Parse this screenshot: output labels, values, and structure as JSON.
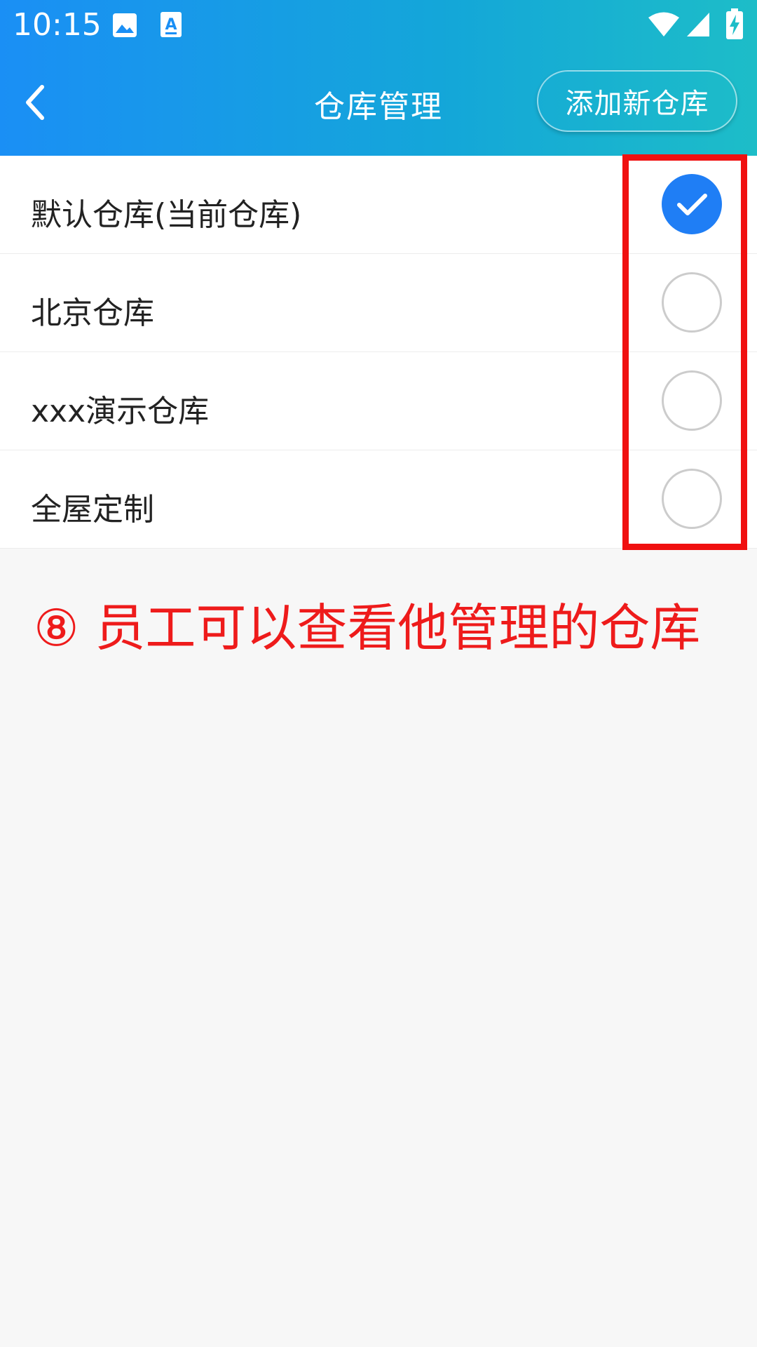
{
  "status_bar": {
    "time": "10:15",
    "icons": [
      "image-icon",
      "text-a-icon",
      "wifi-icon",
      "signal-icon",
      "battery-charging-icon"
    ]
  },
  "nav": {
    "title": "仓库管理",
    "add_button_label": "添加新仓库",
    "back_icon": "chevron-left-icon"
  },
  "warehouses": [
    {
      "label": "默认仓库(当前仓库)",
      "checked": true
    },
    {
      "label": "北京仓库",
      "checked": false
    },
    {
      "label": "xxx演示仓库",
      "checked": false
    },
    {
      "label": "全屋定制",
      "checked": false
    }
  ],
  "annotation": {
    "text": "⑧ 员工可以查看他管理的仓库",
    "color": "#ee1b1b"
  },
  "colors": {
    "accent": "#1f7ef5",
    "header_start": "#1a8ff5",
    "header_end": "#1dbdc8",
    "highlight": "#f01010"
  }
}
